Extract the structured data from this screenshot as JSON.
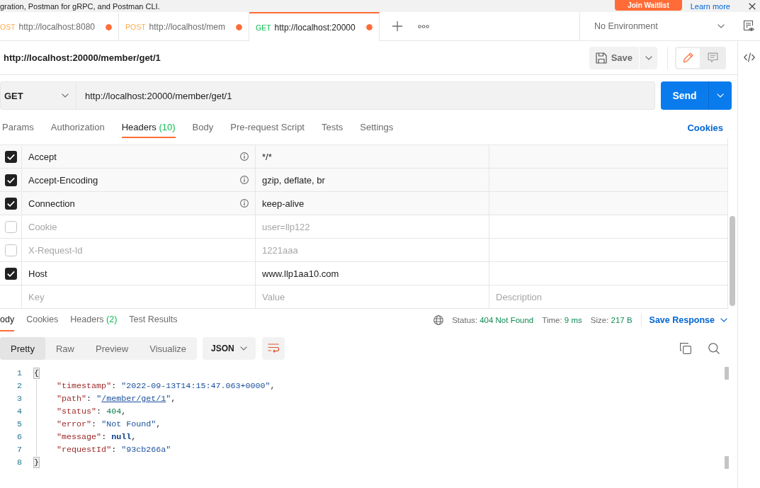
{
  "banner": {
    "text": "gration, Postman for gRPC, and Postman CLI.",
    "button": "Join Waitlist",
    "link": "Learn more"
  },
  "tabs": [
    {
      "method": "OST",
      "color": "#ffad4d",
      "url": "http://localhost:8080",
      "unsaved": true,
      "selected": false
    },
    {
      "method": "POST",
      "color": "#ffad4d",
      "url": "http://localhost/mem",
      "unsaved": true,
      "selected": false
    },
    {
      "method": "GET",
      "color": "#0cbb52",
      "url": "http://localhost:20000",
      "unsaved": true,
      "selected": true
    }
  ],
  "environment": "No Environment",
  "request": {
    "title": "http://localhost:20000/member/get/1",
    "save": "Save",
    "method": "GET",
    "url": "http://localhost:20000/member/get/1",
    "send": "Send"
  },
  "mode_toggle": [
    {
      "kind": "edit",
      "selected": true
    },
    {
      "kind": "comments",
      "selected": false
    }
  ],
  "request_tabs": [
    {
      "label": "Params",
      "selected": false
    },
    {
      "label": "Authorization",
      "selected": false
    },
    {
      "label": "Headers",
      "count": "(10)",
      "selected": true
    },
    {
      "label": "Body",
      "selected": false
    },
    {
      "label": "Pre-request Script",
      "selected": false
    },
    {
      "label": "Tests",
      "selected": false
    },
    {
      "label": "Settings",
      "selected": false
    }
  ],
  "cookies_link": "Cookies",
  "headers": {
    "rows": [
      {
        "checked": true,
        "auto": true,
        "key": "Accept",
        "value": "*/*"
      },
      {
        "checked": true,
        "auto": true,
        "key": "Accept-Encoding",
        "value": "gzip, deflate, br"
      },
      {
        "checked": true,
        "auto": true,
        "key": "Connection",
        "value": "keep-alive"
      },
      {
        "checked": false,
        "auto": false,
        "key": "Cookie",
        "value": "user=llp122"
      },
      {
        "checked": false,
        "auto": false,
        "key": "X-Request-Id",
        "value": "1221aaa"
      },
      {
        "checked": true,
        "auto": false,
        "key": "Host",
        "value": "www.llp1aa10.com"
      }
    ],
    "new_row": {
      "key_placeholder": "Key",
      "value_placeholder": "Value",
      "description_placeholder": "Description"
    }
  },
  "response": {
    "tabs": [
      {
        "label": "ody",
        "selected": true
      },
      {
        "label": "Cookies",
        "selected": false
      },
      {
        "label": "Headers",
        "count": "(2)",
        "selected": false
      },
      {
        "label": "Test Results",
        "selected": false
      }
    ],
    "status_label": "Status:",
    "status": "404 Not Found",
    "time_label": "Time:",
    "time": "9 ms",
    "size_label": "Size:",
    "size": "217 B",
    "save_button": "Save Response",
    "view_modes": [
      {
        "label": "Pretty",
        "selected": true
      },
      {
        "label": "Raw",
        "selected": false
      },
      {
        "label": "Preview",
        "selected": false
      },
      {
        "label": "Visualize",
        "selected": false
      }
    ],
    "format": "JSON",
    "wrap_lines": true,
    "code": [
      {
        "number": "1",
        "tokens": [
          {
            "kind": "bracket",
            "text": "{"
          }
        ],
        "children": [
          {
            "number": "2",
            "tokens": [
              {
                "kind": "key",
                "text": "\"timestamp\""
              },
              {
                "kind": "punct",
                "text": ": "
              },
              {
                "kind": "string",
                "text": "\"2022-09-13T14:15:47.063+0000\""
              },
              {
                "kind": "punct",
                "text": ","
              }
            ]
          },
          {
            "number": "3",
            "tokens": [
              {
                "kind": "key",
                "text": "\"path\""
              },
              {
                "kind": "punct",
                "text": ": "
              },
              {
                "kind": "string",
                "text": "\""
              },
              {
                "kind": "link",
                "text": "/member/get/1"
              },
              {
                "kind": "string",
                "text": "\""
              },
              {
                "kind": "punct",
                "text": ","
              }
            ]
          },
          {
            "number": "4",
            "tokens": [
              {
                "kind": "key",
                "text": "\"status\""
              },
              {
                "kind": "punct",
                "text": ": "
              },
              {
                "kind": "number",
                "text": "404"
              },
              {
                "kind": "punct",
                "text": ","
              }
            ]
          },
          {
            "number": "5",
            "tokens": [
              {
                "kind": "key",
                "text": "\"error\""
              },
              {
                "kind": "punct",
                "text": ": "
              },
              {
                "kind": "string",
                "text": "\"Not Found\""
              },
              {
                "kind": "punct",
                "text": ","
              }
            ]
          },
          {
            "number": "6",
            "tokens": [
              {
                "kind": "key",
                "text": "\"message\""
              },
              {
                "kind": "punct",
                "text": ": "
              },
              {
                "kind": "keyword",
                "text": "null"
              },
              {
                "kind": "punct",
                "text": ","
              }
            ]
          },
          {
            "number": "7",
            "tokens": [
              {
                "kind": "key",
                "text": "\"requestId\""
              },
              {
                "kind": "punct",
                "text": ": "
              },
              {
                "kind": "string",
                "text": "\"93cb266a\""
              }
            ]
          }
        ]
      },
      {
        "number": "8",
        "tokens": [
          {
            "kind": "bracket",
            "text": "}"
          }
        ]
      }
    ]
  }
}
